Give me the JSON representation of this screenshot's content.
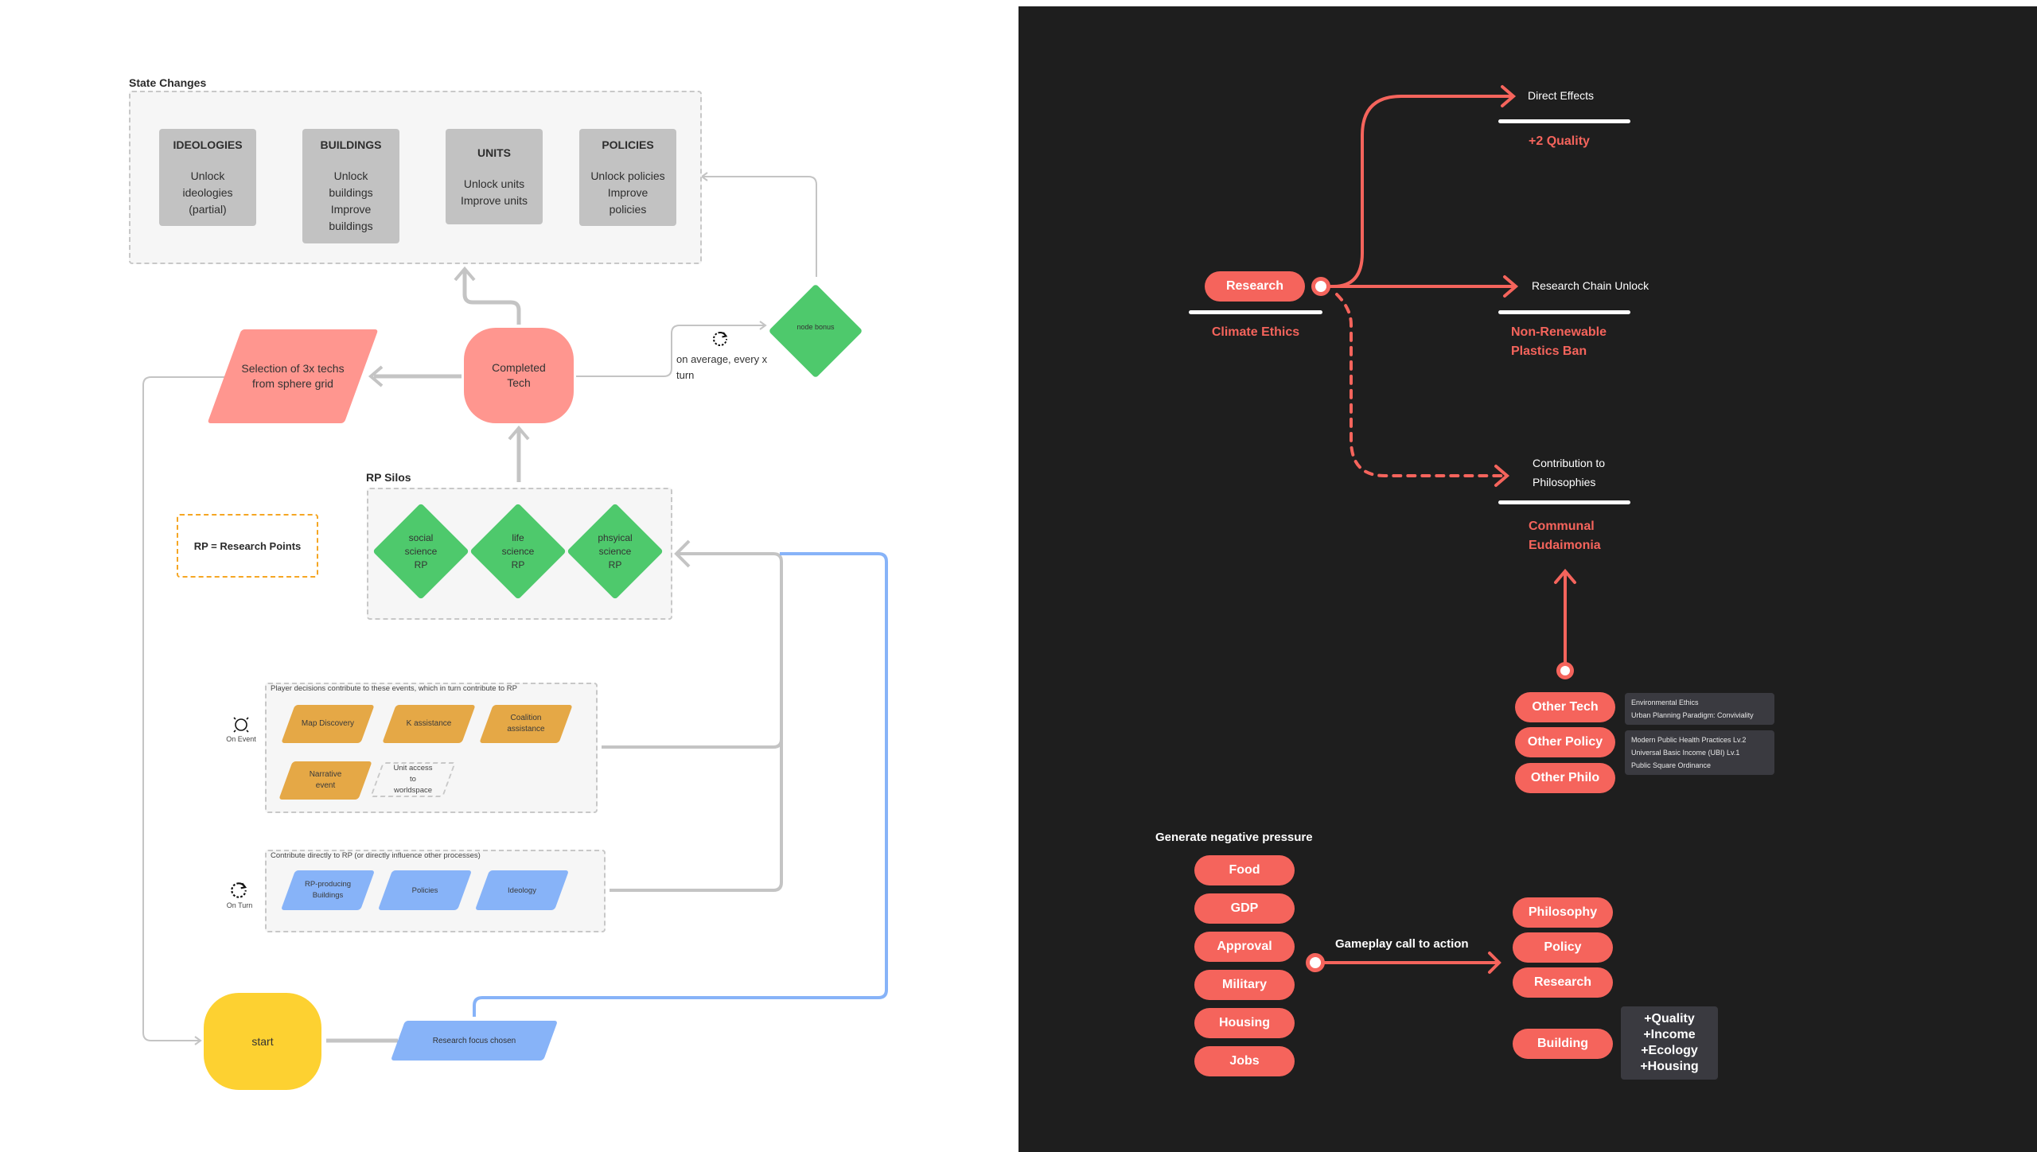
{
  "left_panel": {
    "state_changes": {
      "label": "State Changes",
      "cards": [
        {
          "title": "IDEOLOGIES",
          "lines": [
            "Unlock",
            "ideologies",
            "(partial)"
          ]
        },
        {
          "title": "BUILDINGS",
          "lines": [
            "Unlock",
            "buildings",
            "Improve",
            "buildings"
          ]
        },
        {
          "title": "UNITS",
          "lines": [
            "Unlock units",
            "Improve units"
          ]
        },
        {
          "title": "POLICIES",
          "lines": [
            "Unlock policies",
            "Improve",
            "policies"
          ]
        }
      ]
    },
    "selection_node": "Selection of 3x techs from sphere grid",
    "completed_tech": "Completed Tech",
    "frequency_note": "on average, every x turn",
    "node_bonus": "node bonus",
    "legend": "RP = Research Points",
    "rp_silos": {
      "label": "RP Silos",
      "silos": [
        "social science RP",
        "life science RP",
        "phsyical science RP"
      ]
    },
    "on_event": {
      "icon_label": "On Event",
      "caption": "Player decisions contribute to these events, which in turn contribute to RP",
      "items": [
        "Map Discovery",
        "K assistance",
        "Coalition assistance",
        "Narrative event"
      ],
      "dashed_item": "Unit access to worldspace"
    },
    "on_turn": {
      "icon_label": "On Turn",
      "caption": "Contribute directly to RP (or directly influence other processes)",
      "items": [
        "RP-producing Buildings",
        "Policies",
        "Ideology"
      ]
    },
    "start": "start",
    "research_focus": "Research focus chosen"
  },
  "right_panel": {
    "research_pill": "Research",
    "source_name": "Climate Ethics",
    "branches": [
      {
        "label": "Direct Effects",
        "value": "+2 Quality"
      },
      {
        "label": "Research Chain Unlock",
        "value": "Non-Renewable Plastics Ban"
      },
      {
        "label": "Contribution to Philosophies",
        "value": "Communal Eudaimonia"
      }
    ],
    "others": [
      {
        "label": "Other Tech",
        "details": [
          "Environmental Ethics",
          "Urban Planning Paradigm: Conviviality"
        ]
      },
      {
        "label": "Other Policy",
        "details": [
          "Modern Public Health Practices Lv.2",
          "Universal Basic Income (UBI) Lv.1",
          "Public Square Ordinance"
        ]
      },
      {
        "label": "Other Philo",
        "details": []
      }
    ],
    "pressure": {
      "title": "Generate negative pressure",
      "items": [
        "Food",
        "GDP",
        "Approval",
        "Military",
        "Housing",
        "Jobs"
      ]
    },
    "call_to_action": "Gameplay call to action",
    "actions": [
      "Philosophy",
      "Policy",
      "Research"
    ],
    "building": {
      "label": "Building",
      "effects": [
        "+Quality",
        "+Income",
        "+Ecology",
        "+Housing"
      ]
    }
  },
  "colors": {
    "dark_bg": "#1e1e1e",
    "coral": "#f5645c",
    "salmon": "#ff968f",
    "green": "#4ec96c",
    "orange": "#e5a846",
    "blue": "#87b3f8",
    "yellow": "#fdd131",
    "gray_card": "#c2c2c2",
    "connector": "#c4c4c4"
  }
}
